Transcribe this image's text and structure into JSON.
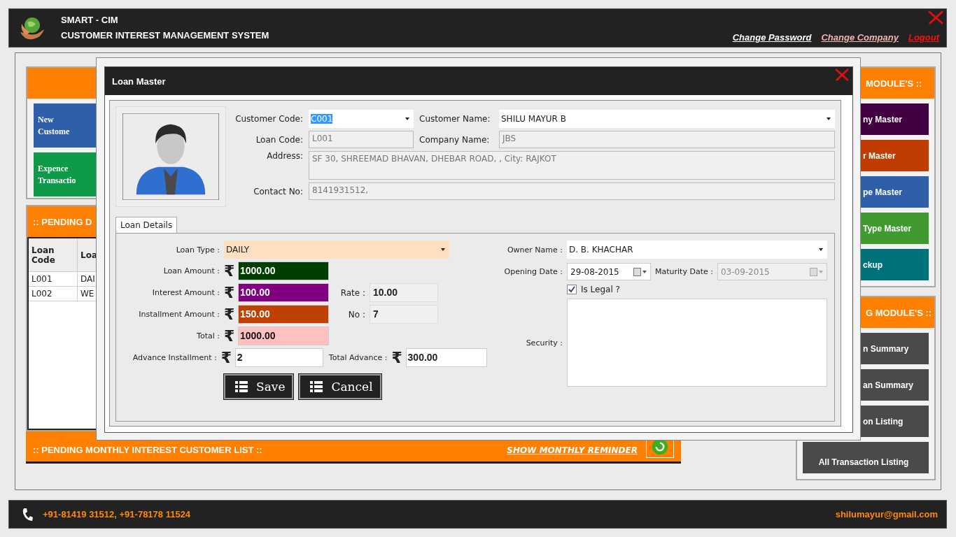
{
  "app": {
    "title": "SMART - CIM",
    "subtitle": "CUSTOMER INTEREST MANAGEMENT SYSTEM",
    "links": [
      {
        "label": "Change Password",
        "color": "#ffffff"
      },
      {
        "label": "Change Company",
        "color": "#f4b4b4"
      },
      {
        "label": "Logout",
        "color": "#ff1010"
      }
    ]
  },
  "left_panel": {
    "buttons": [
      {
        "label": "New\nCustome",
        "color": "#2e5fa8"
      },
      {
        "label": "Expence\nTransactio",
        "color": "#0f9a4a"
      }
    ]
  },
  "pending_daily": {
    "title": ":: PENDING D",
    "columns": [
      "Loan\nCode",
      "Loa"
    ],
    "rows": [
      [
        "L001",
        "DAI"
      ],
      [
        "L002",
        "WE"
      ]
    ]
  },
  "pending_monthly": {
    "title": ":: PENDING MONTHLY INTEREST CUSTOMER LIST ::",
    "link": "SHOW MONTHLY REMINDER"
  },
  "right_panel": {
    "masters_title": "MODULE'S ::",
    "masters": [
      {
        "label": "ny Master",
        "color": "#420042"
      },
      {
        "label": "r Master",
        "color": "#c03c00"
      },
      {
        "label": "pe Master",
        "color": "#2e5fa8"
      },
      {
        "label": "Type Master",
        "color": "#3f9a30"
      },
      {
        "label": "ckup",
        "color": "#00727a"
      }
    ],
    "reports_title": "G MODULE'S ::",
    "reports": [
      "n Summary",
      "an Summary",
      "on Listing",
      "All Transaction Listing"
    ]
  },
  "footer": {
    "phone": "+91-81419 31512, +91-78178 11524",
    "email": "shilumayur@gmail.com"
  },
  "dialog": {
    "title": "Loan Master",
    "customer_code": {
      "label": "Customer Code:",
      "value": "C001"
    },
    "customer_name": {
      "label": "Customer Name:",
      "value": "SHILU MAYUR B"
    },
    "loan_code": {
      "label": "Loan Code:",
      "value": "L001"
    },
    "company_name": {
      "label": "Company Name:",
      "value": "JBS"
    },
    "address": {
      "label": "Address:",
      "value": "SF 30, SHREEMAD BHAVAN, DHEBAR ROAD, , City: RAJKOT"
    },
    "contact_no": {
      "label": "Contact No:",
      "value": "8141931512,"
    },
    "tabs": [
      {
        "label": "Loan Details",
        "selected": true
      }
    ],
    "loan_type": {
      "label": "Loan Type :",
      "value": "DAILY"
    },
    "amounts": [
      {
        "label": "Loan Amount :",
        "currency": "₹",
        "value": "1000.00",
        "color": "#003f00"
      },
      {
        "label": "Interest Amount :",
        "currency": "₹",
        "value": "100.00",
        "color": "#800080"
      },
      {
        "label": "Installment Amount :",
        "currency": "₹",
        "value": "150.00",
        "color": "#c04000"
      },
      {
        "label": "Total :",
        "currency": "₹",
        "value": "1000.00",
        "color": "#ffc0c0"
      },
      {
        "label": "Advance Installment :",
        "currency": "₹",
        "value": "2",
        "color": "#ffffff"
      }
    ],
    "rate": {
      "label": "Rate :",
      "value": "10.00"
    },
    "number": {
      "label": "No :",
      "value": "7"
    },
    "total_advance": {
      "label": "Total Advance :",
      "currency": "₹",
      "value": "300.00"
    },
    "owner_name": {
      "label": "Owner Name :",
      "value": "D. B. KHACHAR"
    },
    "opening_date": {
      "label": "Opening Date :",
      "value": "29-08-2015",
      "disabled": false
    },
    "maturity_date": {
      "label": "Maturity Date :",
      "value": "03-09-2015",
      "disabled": true
    },
    "is_legal": {
      "label": "Is Legal ?",
      "checked": true
    },
    "security": {
      "label": "Security :"
    },
    "buttons": [
      "Save",
      "Cancel"
    ]
  }
}
